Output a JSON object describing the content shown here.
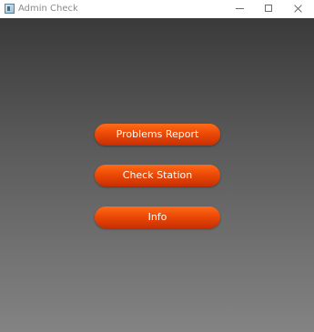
{
  "window": {
    "title": "Admin Check",
    "controls": {
      "minimize": "minimize-icon",
      "maximize": "maximize-icon",
      "close": "close-icon"
    }
  },
  "menu": {
    "buttons": [
      {
        "label": "Problems Report"
      },
      {
        "label": "Check Station"
      },
      {
        "label": "Info"
      }
    ]
  },
  "colors": {
    "button_accent": "#ec4a06",
    "background_top": "#3a3a3a",
    "background_bottom": "#838383"
  }
}
